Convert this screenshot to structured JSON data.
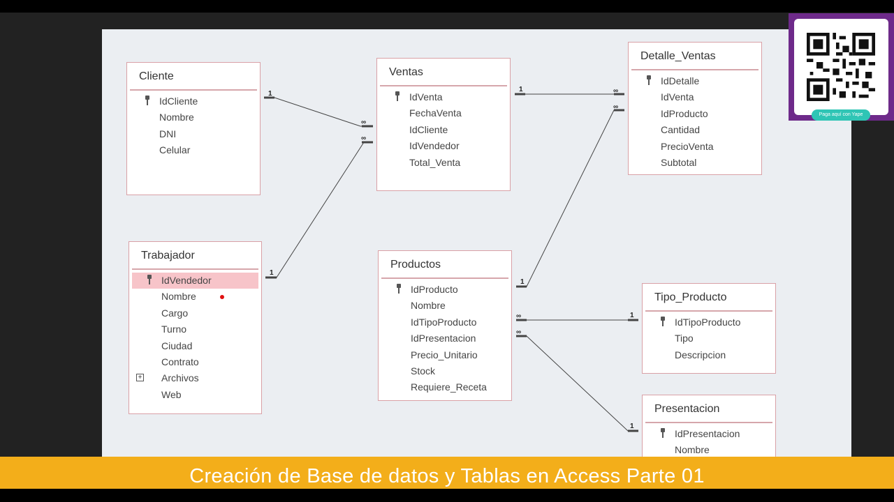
{
  "tables": {
    "cliente": {
      "title": "Cliente",
      "fields": [
        "IdCliente",
        "Nombre",
        "DNI",
        "Celular"
      ]
    },
    "ventas": {
      "title": "Ventas",
      "fields": [
        "IdVenta",
        "FechaVenta",
        "IdCliente",
        "IdVendedor",
        "Total_Venta"
      ]
    },
    "detalle_ventas": {
      "title": "Detalle_Ventas",
      "fields": [
        "IdDetalle",
        "IdVenta",
        "IdProducto",
        "Cantidad",
        "PrecioVenta",
        "Subtotal"
      ]
    },
    "trabajador": {
      "title": "Trabajador",
      "fields": [
        "IdVendedor",
        "Nombre",
        "Cargo",
        "Turno",
        "Ciudad",
        "Contrato",
        "Archivos",
        "Web"
      ]
    },
    "productos": {
      "title": "Productos",
      "fields": [
        "IdProducto",
        "Nombre",
        "IdTipoProducto",
        "IdPresentacion",
        "Precio_Unitario",
        "Stock",
        "Requiere_Receta"
      ]
    },
    "tipo_producto": {
      "title": "Tipo_Producto",
      "fields": [
        "IdTipoProducto",
        "Tipo",
        "Descripcion"
      ]
    },
    "presentacion": {
      "title": "Presentacion",
      "fields": [
        "IdPresentacion",
        "Nombre"
      ]
    }
  },
  "relationship_labels": {
    "one": "1",
    "many": "∞"
  },
  "qr": {
    "button_label": "Paga aquí con Yape"
  },
  "banner": {
    "title": "Creación de Base de datos y Tablas en Access Parte 01"
  },
  "colors": {
    "banner": "#f3ae1a",
    "qr_panel": "#6e2a8a",
    "selected_row": "#f7c4c9",
    "table_border": "#d9a0a6"
  }
}
